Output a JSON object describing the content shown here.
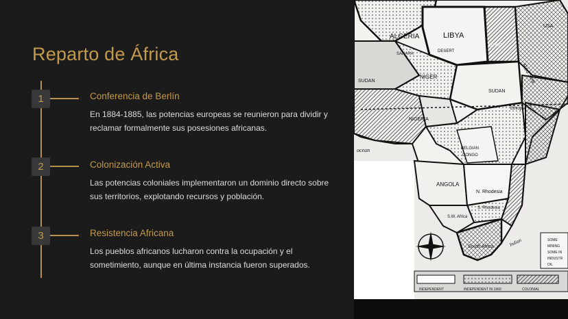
{
  "slide": {
    "title": "Reparto de África",
    "steps": [
      {
        "number": "1",
        "heading": "Conferencia de Berlín",
        "body": "En 1884-1885, las potencias europeas se reunieron para dividir y reclamar formalmente sus posesiones africanas."
      },
      {
        "number": "2",
        "heading": "Colonización Activa",
        "body": "Las potencias coloniales implementaron un dominio directo sobre sus territorios, explotando recursos y población."
      },
      {
        "number": "3",
        "heading": "Resistencia Africana",
        "body": "Los pueblos africanos lucharon contra la ocupación y el sometimiento, aunque en última instancia fueron superados."
      }
    ]
  },
  "map": {
    "labels": {
      "algeria": "ALGERIA",
      "sahara": "SAHARA",
      "libya": "LIBYA",
      "desert": "DESERT",
      "egypt": "EGYPT",
      "red_sea": "Red Sea",
      "nigeria": "NIGERIA",
      "niger": "NIGER",
      "sudan": "SUDAN",
      "sudan_w": "SUDAN",
      "ethiopia": "Ethiopia",
      "ocean": "ocean",
      "congo": "CONGO",
      "belgian": "BELGIAN",
      "angola": "ANGOLA",
      "n_rhodesia": "N. Rhodesia",
      "s_rhodesia": "S. Rhodesia",
      "sw_africa": "S.W. Africa",
      "south_africa": "South Africa",
      "indian": "Indian",
      "usa": "USA"
    },
    "legend_bar": {
      "independent": "INDEPENDENT",
      "independent_1960": "INDEPENDENT IN 1960",
      "colonial": "COLONIAL"
    },
    "resource_legend": [
      "SOME",
      "MINING",
      "SOME IN",
      "INDUSTR",
      "OIL"
    ]
  }
}
